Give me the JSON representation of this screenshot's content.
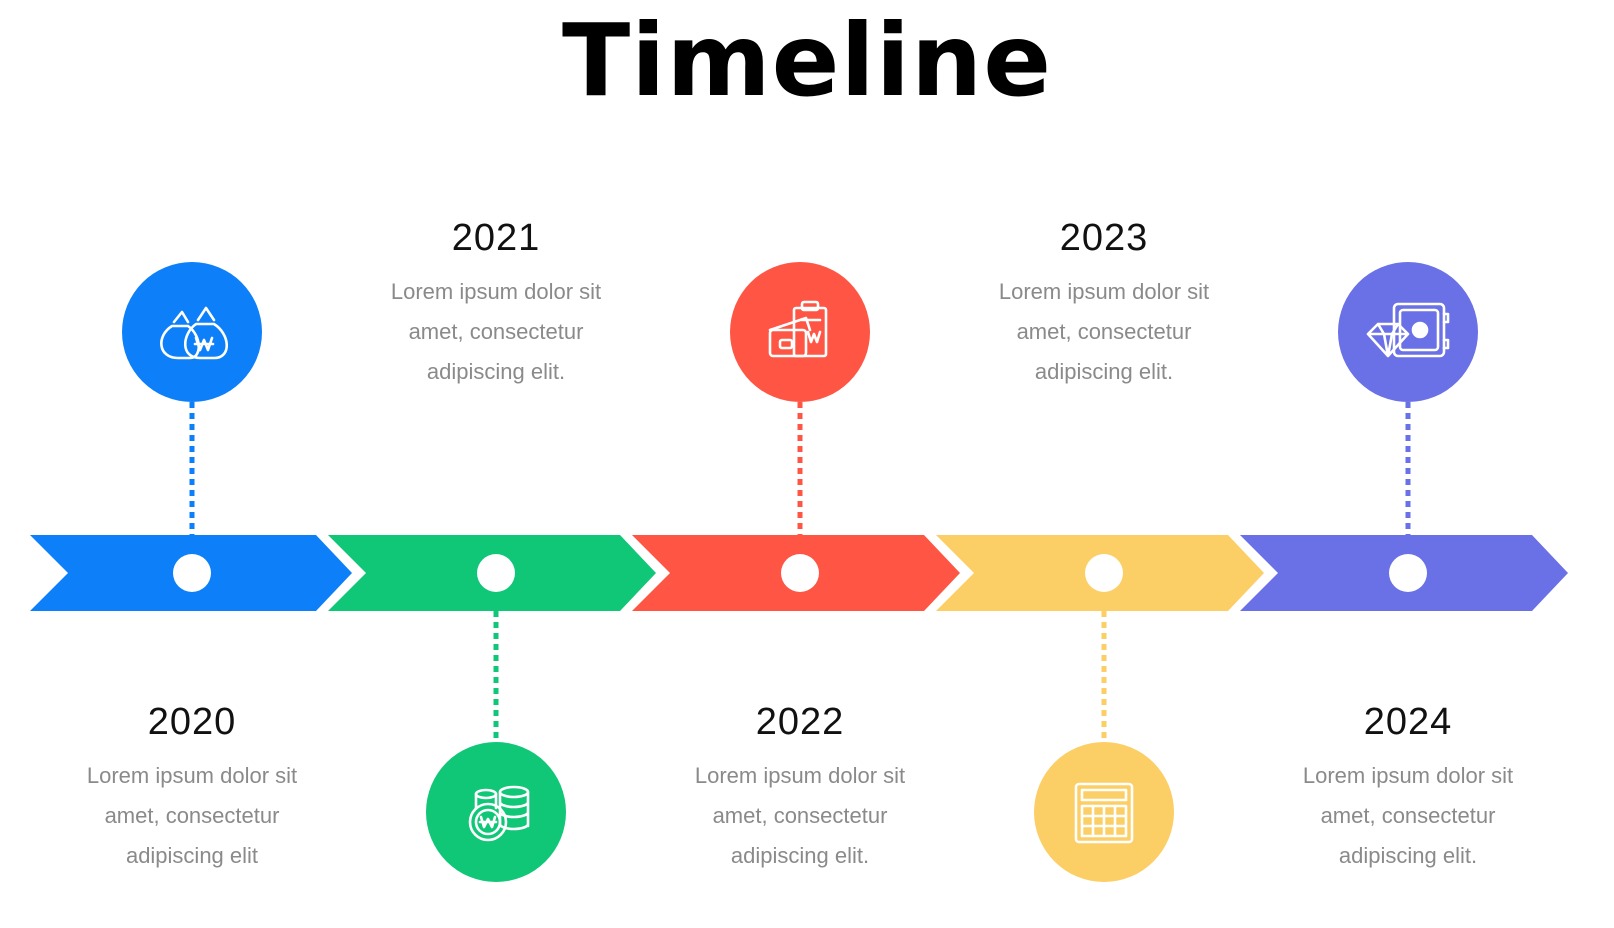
{
  "title": "Timeline",
  "items": [
    {
      "year": "2020",
      "lines": [
        "Lorem ipsum dolor sit",
        "amet, consectetur",
        "adipiscing elit"
      ],
      "color": "#0d80f9",
      "icon": "money-bags-icon",
      "position": "top"
    },
    {
      "year": "2021",
      "lines": [
        "Lorem ipsum dolor sit",
        "amet, consectetur",
        "adipiscing elit."
      ],
      "color": "#10c777",
      "icon": "coin-stack-icon",
      "position": "bottom"
    },
    {
      "year": "2022",
      "lines": [
        "Lorem ipsum dolor sit",
        "amet, consectetur",
        "adipiscing elit."
      ],
      "color": "#ff5544",
      "icon": "wallet-clipboard-icon",
      "position": "top"
    },
    {
      "year": "2023",
      "lines": [
        "Lorem ipsum dolor sit",
        "amet, consectetur",
        "adipiscing elit."
      ],
      "color": "#fcce66",
      "icon": "calculator-icon",
      "position": "bottom"
    },
    {
      "year": "2024",
      "lines": [
        "Lorem ipsum dolor sit",
        "amet, consectetur",
        "adipiscing elit."
      ],
      "color": "#6a70e5",
      "icon": "diamond-safe-icon",
      "position": "top"
    }
  ]
}
